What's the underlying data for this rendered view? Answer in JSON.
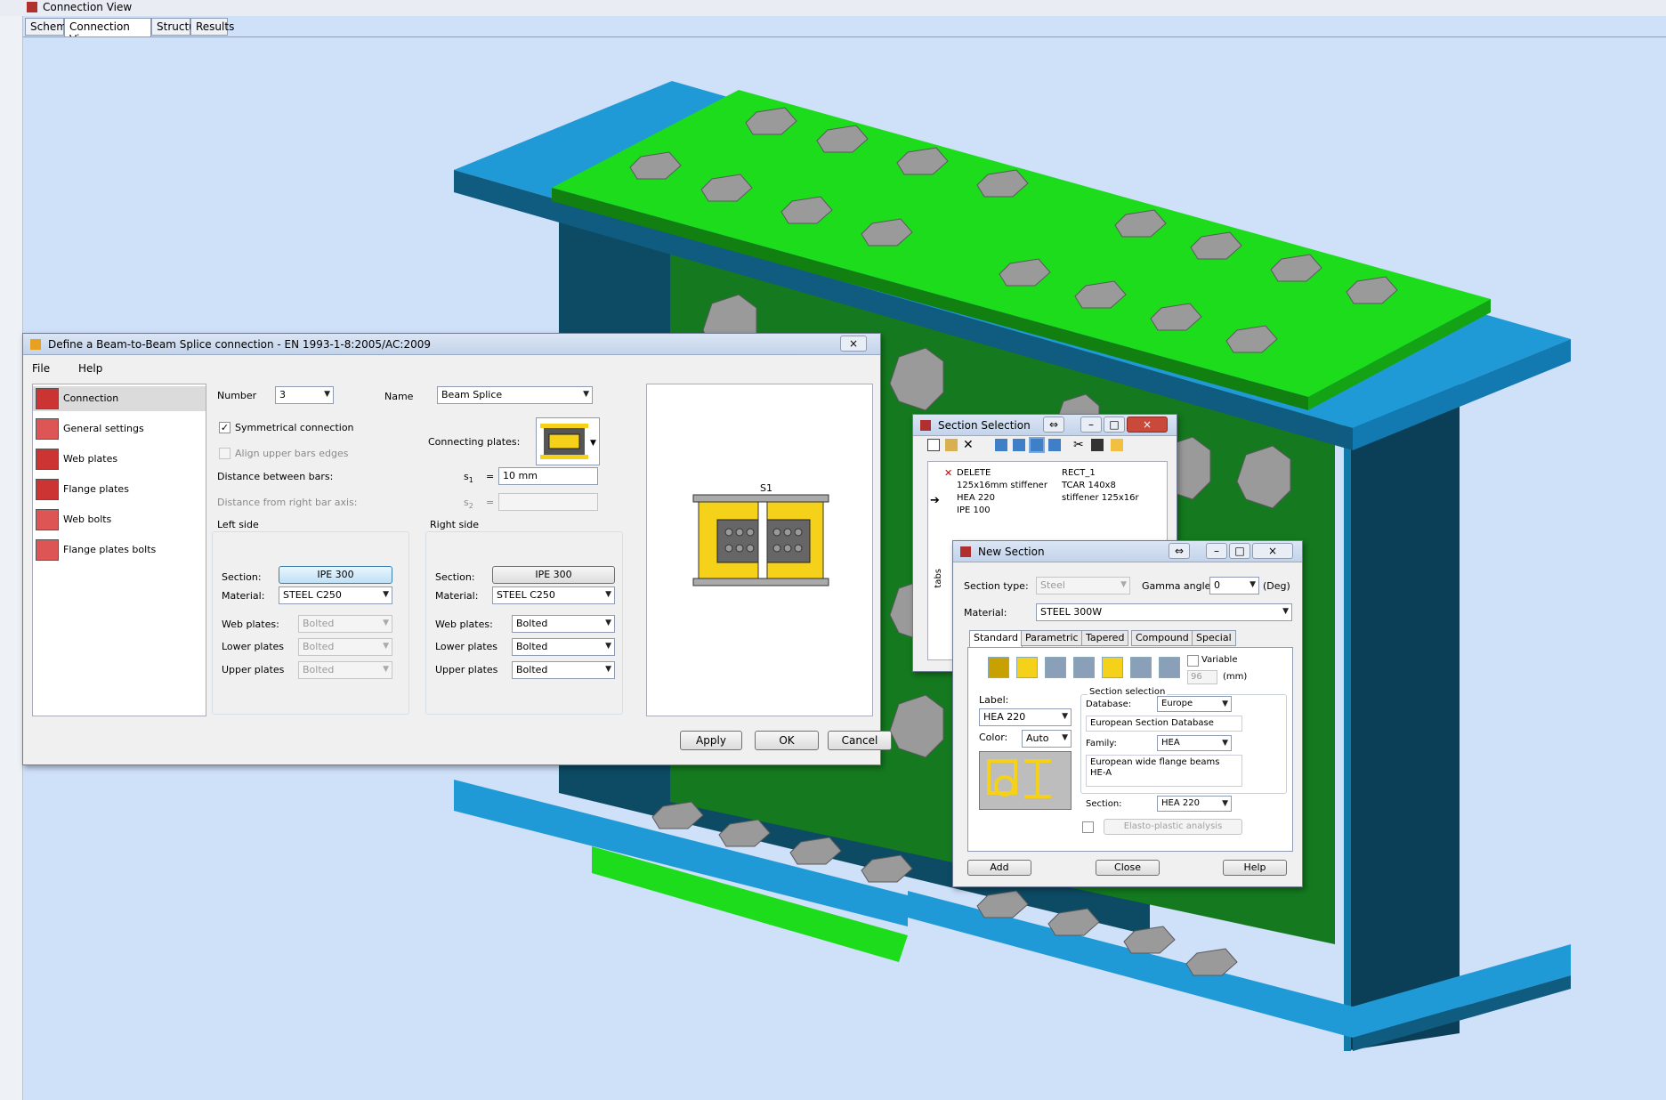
{
  "app": {
    "title": "Connection View",
    "tabs": [
      "Scheme",
      "Connection View",
      "Structure",
      "Results"
    ]
  },
  "colors": {
    "viewport_bg": "#cfe0f9",
    "beam_blue": "#1f9ad6",
    "beam_dark": "#0d4a63",
    "plate_green": "#1cdc1c",
    "web_green": "#14791f",
    "bolt_grey": "#8f8f8f",
    "highlight_yellow": "#f5d11a"
  },
  "splice_dialog": {
    "title": "Define a Beam-to-Beam Splice connection - EN 1993-1-8:2005/AC:2009",
    "close": "×",
    "menu": [
      "File",
      "Help"
    ],
    "nav": [
      "Connection",
      "General settings",
      "Web plates",
      "Flange plates",
      "Web bolts",
      "Flange plates bolts"
    ],
    "number_label": "Number",
    "number_value": "3",
    "name_label": "Name",
    "name_value": "Beam Splice",
    "symmetrical_label": "Symmetrical connection",
    "symmetrical_check": "✓",
    "align_label": "Align upper bars edges",
    "connecting_plates_label": "Connecting plates:",
    "distance_bars_label": "Distance between bars:",
    "s1_label": "s",
    "s1_sub": "1",
    "eq": "=",
    "s1_value": "10 mm",
    "distance_axis_label": "Distance from right bar axis:",
    "s2_label": "s",
    "s2_sub": "2",
    "left_side": {
      "title": "Left side",
      "section_label": "Section:",
      "section_value": "IPE 300",
      "material_label": "Material:",
      "material_value": "STEEL C250",
      "web_label": "Web plates:",
      "web_value": "Bolted",
      "lower_label": "Lower plates",
      "lower_value": "Bolted",
      "upper_label": "Upper plates",
      "upper_value": "Bolted"
    },
    "right_side": {
      "title": "Right side",
      "section_label": "Section:",
      "section_value": "IPE 300",
      "material_label": "Material:",
      "material_value": "STEEL C250",
      "web_label": "Web plates:",
      "web_value": "Bolted",
      "lower_label": "Lower plates",
      "lower_value": "Bolted",
      "upper_label": "Upper plates",
      "upper_value": "Bolted"
    },
    "preview_s1": "S1",
    "apply": "Apply",
    "ok": "OK",
    "cancel": "Cancel"
  },
  "section_selection": {
    "title": "Section Selection",
    "items_left": [
      "DELETE",
      "125x16mm stiffener",
      "HEA 220",
      "IPE 100"
    ],
    "items_right": [
      "RECT_1",
      "TCAR 140x8",
      "stiffener 125x16r"
    ],
    "vertical_tab": "tabs"
  },
  "new_section": {
    "title": "New Section",
    "section_type_label": "Section type:",
    "section_type_value": "Steel",
    "gamma_label": "Gamma angle:",
    "gamma_value": "0",
    "gamma_unit": "(Deg)",
    "material_label": "Material:",
    "material_value": "STEEL 300W",
    "tabs": [
      "Standard",
      "Parametric",
      "Tapered",
      "Compound",
      "Special"
    ],
    "variable_label": "Variable",
    "variable_value": "96",
    "variable_unit": "(mm)",
    "label_label": "Label:",
    "label_value": "HEA 220",
    "color_label": "Color:",
    "color_value": "Auto",
    "section_selection_group": "Section selection",
    "database_label": "Database:",
    "database_value": "Europe",
    "database_desc": "European Section Database",
    "family_label": "Family:",
    "family_value": "HEA",
    "family_desc": "European wide flange beams\nHE-A",
    "section_label": "Section:",
    "section_value": "HEA 220",
    "elasto_label": "Elasto-plastic analysis",
    "add": "Add",
    "close": "Close",
    "help": "Help"
  }
}
